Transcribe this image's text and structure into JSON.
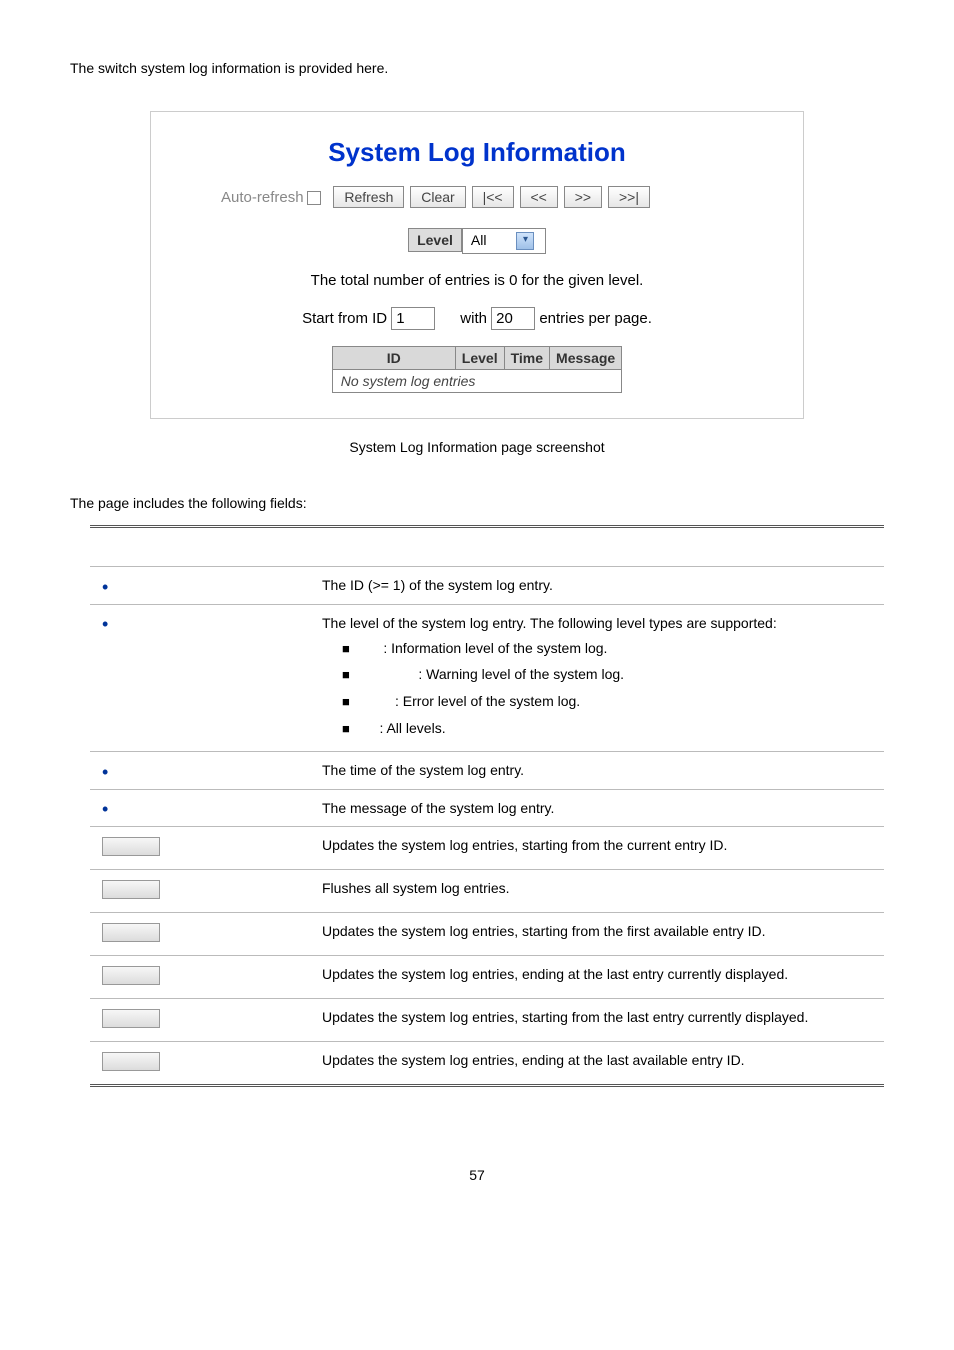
{
  "intro": "The switch system log information is provided here.",
  "screenshot": {
    "title": "System Log Information",
    "auto_refresh": "Auto-refresh",
    "refresh": "Refresh",
    "clear": "Clear",
    "first": "|<<",
    "prev": "<<",
    "next": ">>",
    "last": ">>|",
    "level_label": "Level",
    "level_value": "All",
    "total_line": "The total number of entries is 0 for the given level.",
    "start_from": "Start from ID",
    "start_id": "1",
    "with": "with",
    "entries_value": "20",
    "entries_per_page": "entries per page.",
    "th_id": "ID",
    "th_level": "Level",
    "th_time": "Time",
    "th_message": "Message",
    "no_entries": "No system log entries"
  },
  "caption": "System Log Information page screenshot",
  "fields_intro": "The page includes the following fields:",
  "fields": {
    "id_desc": "The ID (>= 1) of the system log entry.",
    "level_intro": "The level of the system log entry. The following level types are supported:",
    "level_info": ": Information level of the system log.",
    "level_warning": ": Warning level of the system log.",
    "level_error": ": Error level of the system log.",
    "level_all": ": All levels.",
    "time_desc": "The time of the system log entry.",
    "message_desc": "The message of the system log entry.",
    "refresh_desc": "Updates the system log entries, starting from the current entry ID.",
    "clear_desc": "Flushes all system log entries.",
    "first_desc": "Updates the system log entries, starting from the first available entry ID.",
    "prev_desc": "Updates the system log entries, ending at the last entry currently displayed.",
    "next_desc": "Updates the system log entries, starting from the last entry currently displayed.",
    "last_desc": "Updates the system log entries, ending at the last available entry ID."
  },
  "page_number": "57"
}
